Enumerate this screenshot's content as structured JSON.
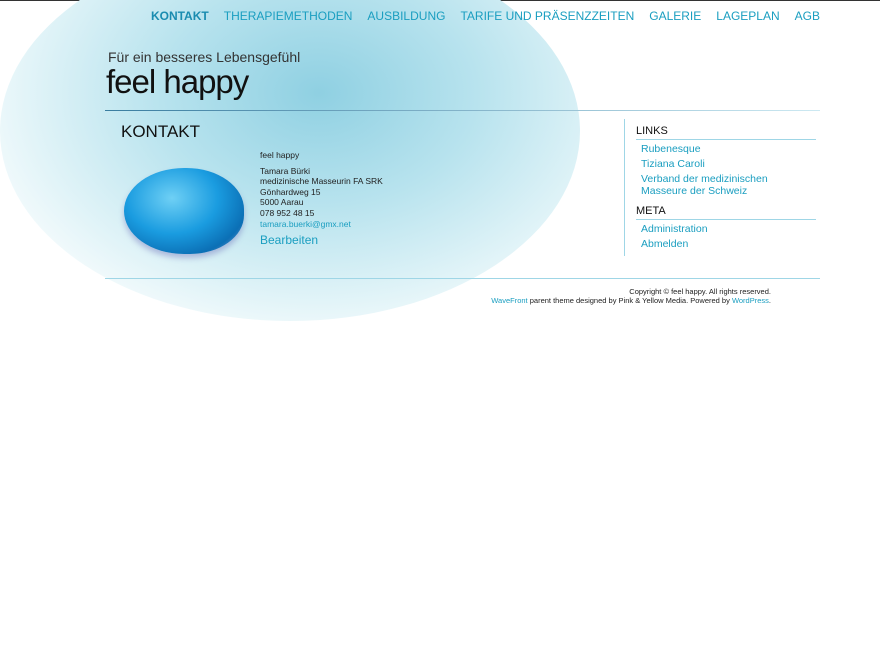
{
  "nav": {
    "items": [
      "KONTAKT",
      "THERAPIEMETHODEN",
      "AUSBILDUNG",
      "TARIFE UND PRÄSENZZEITEN",
      "GALERIE",
      "LAGEPLAN",
      "AGB"
    ],
    "active": "KONTAKT"
  },
  "header": {
    "tagline": "Für ein besseres Lebensgefühl",
    "title": "feel happy"
  },
  "main": {
    "heading": "KONTAKT",
    "company": "feel happy",
    "name": "Tamara Bürki",
    "profession": "medizinische Masseurin FA SRK",
    "street": "Gönhardweg 15",
    "city": "5000 Aarau",
    "phone": "078 952 48 15",
    "email": "tamara.buerki@gmx.net",
    "edit": "Bearbeiten"
  },
  "sidebar": {
    "links_title": "LINKS",
    "links": [
      "Rubenesque",
      "Tiziana Caroli",
      "Verband der medizinischen Masseure der Schweiz"
    ],
    "meta_title": "META",
    "meta": [
      "Administration",
      "Abmelden"
    ]
  },
  "footer": {
    "copyright": "Copyright © feel happy. All rights reserved.",
    "theme_link": "WaveFront",
    "theme_text": " parent theme designed by Pink & Yellow Media. Powered by ",
    "wp_link": "WordPress",
    "end": "."
  }
}
